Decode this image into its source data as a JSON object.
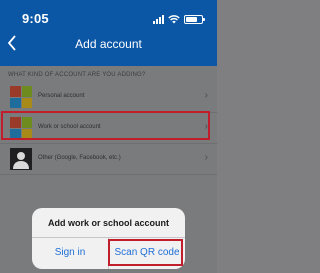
{
  "status_bar": {
    "time": "9:05",
    "battery_level": 0.75
  },
  "header": {
    "title": "Add account",
    "back_icon": "chevron-left-icon"
  },
  "section": {
    "label": "WHAT KIND OF ACCOUNT ARE YOU ADDING?"
  },
  "accounts": [
    {
      "label": "Personal account",
      "icon": "microsoft-logo-icon"
    },
    {
      "label": "Work or school account",
      "icon": "microsoft-logo-icon",
      "highlighted": true
    },
    {
      "label": "Other (Google, Facebook, etc.)",
      "icon": "person-silhouette-icon"
    }
  ],
  "dialog": {
    "title": "Add work or school account",
    "sign_in": "Sign in",
    "scan_qr": "Scan QR code"
  },
  "colors": {
    "header": "#0b56a5",
    "highlight": "#c01e2a",
    "link": "#1f6fd6",
    "dimmed_background": "#7a7b7d"
  }
}
